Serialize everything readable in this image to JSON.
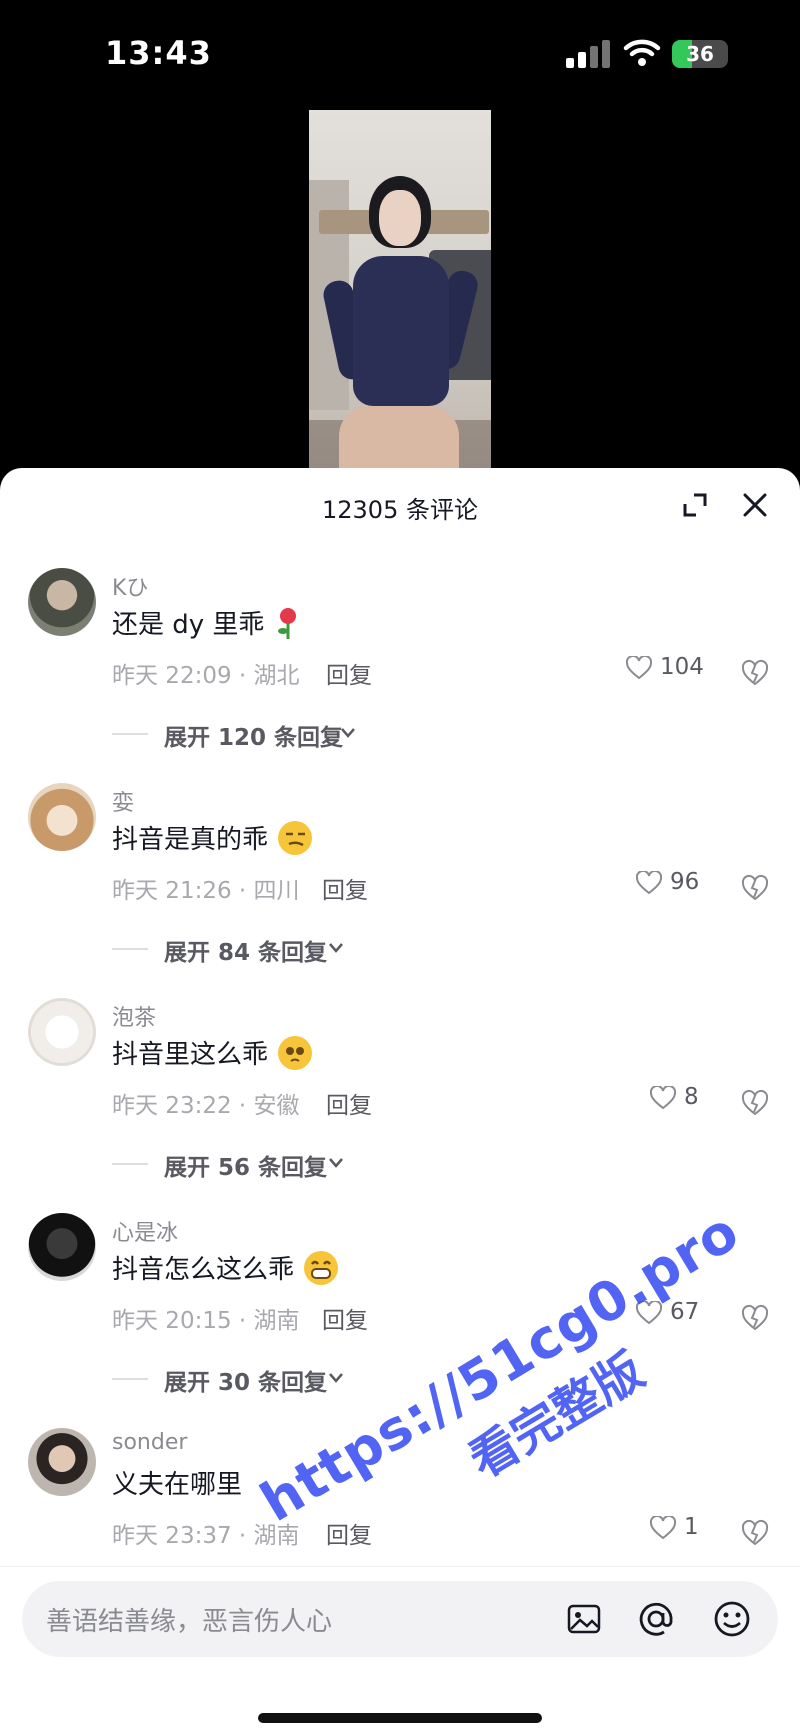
{
  "status_bar": {
    "time": "13:43",
    "battery": "36",
    "battery_color": "#34c759"
  },
  "sheet": {
    "title": "12305 条评论",
    "expand_icon": "expand-icon",
    "close_icon": "close-icon"
  },
  "comments": [
    {
      "username": "Kひ",
      "content": "还是 dy 里乖",
      "emoji": "rose-emoji",
      "meta": "昨天 22:09 · 湖北",
      "reply_label": "回复",
      "likes": "104",
      "expand_label": "展开 120 条回复"
    },
    {
      "username": "娈",
      "content": "抖音是真的乖",
      "emoji": "smirk-emoji",
      "meta": "昨天 21:26 · 四川",
      "reply_label": "回复",
      "likes": "96",
      "expand_label": "展开 84 条回复"
    },
    {
      "username": "泡茶",
      "content": "抖音里这么乖",
      "emoji": "pleading-emoji",
      "meta": "昨天 23:22 · 安徽",
      "reply_label": "回复",
      "likes": "8",
      "expand_label": "展开 56 条回复"
    },
    {
      "username": "心是冰",
      "content": "抖音怎么这么乖",
      "emoji": "grin-emoji",
      "meta": "昨天 20:15 · 湖南",
      "reply_label": "回复",
      "likes": "67",
      "expand_label": "展开 30 条回复"
    },
    {
      "username": "sonder",
      "content": "义夫在哪里",
      "meta": "昨天 23:37 · 湖南",
      "reply_label": "回复",
      "likes": "1"
    }
  ],
  "input": {
    "placeholder": "善语结善缘，恶言伤人心",
    "image_icon": "image-icon",
    "at_icon": "at-icon",
    "emoji_icon": "emoji-icon"
  },
  "watermark": {
    "line1": "https://51cg0.pro",
    "line2": "看完整版"
  },
  "colors": {
    "accent_text": "#161823",
    "secondary_text": "#8a8b91",
    "watermark": "#3b4ff2"
  }
}
